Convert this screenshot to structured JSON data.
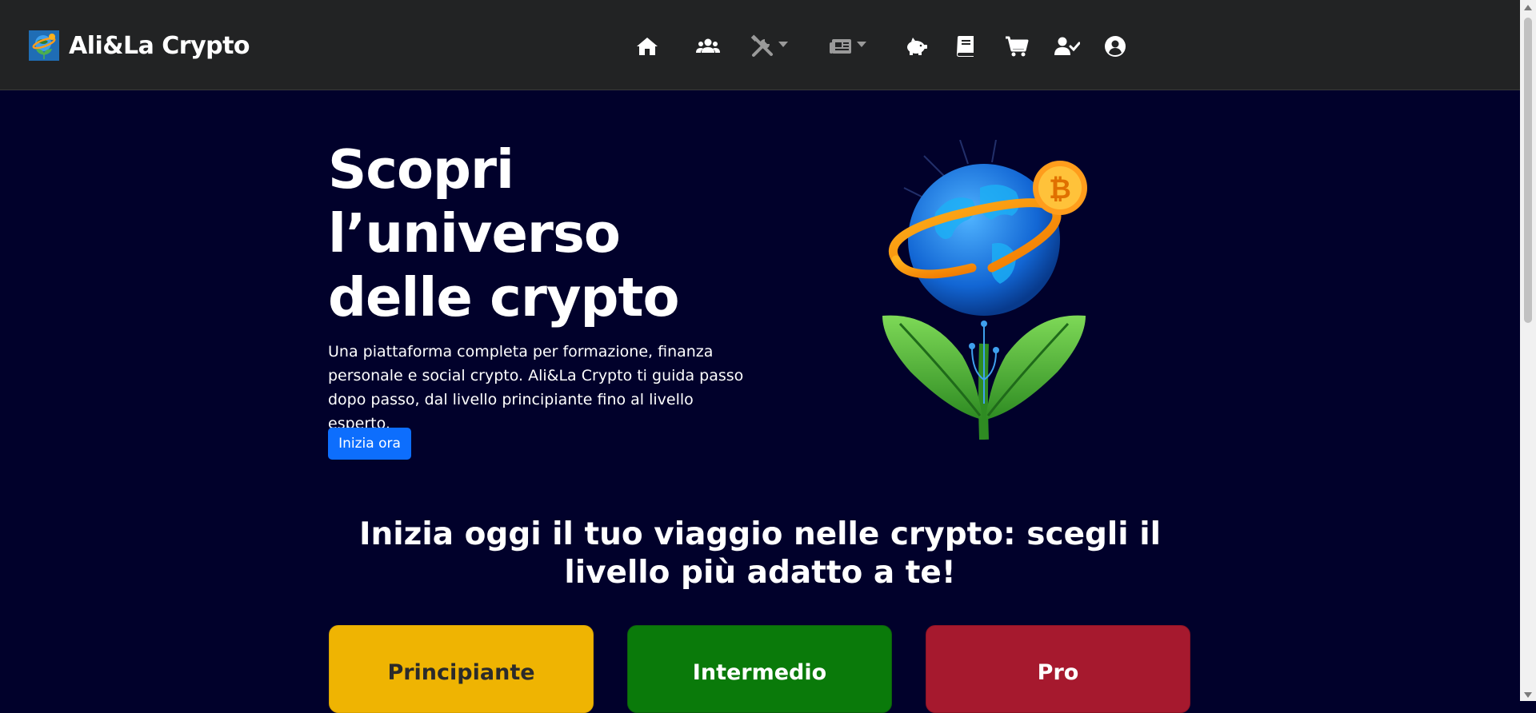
{
  "navbar": {
    "brand_name": "Ali&La Crypto",
    "icons": [
      {
        "name": "home-icon"
      },
      {
        "name": "users-icon"
      },
      {
        "name": "tools-icon",
        "dropdown": true
      },
      {
        "name": "newspaper-icon",
        "dropdown": true
      },
      {
        "name": "piggy-bank-icon"
      },
      {
        "name": "book-icon"
      },
      {
        "name": "cart-icon"
      },
      {
        "name": "user-check-icon"
      },
      {
        "name": "user-circle-icon"
      }
    ]
  },
  "hero": {
    "title_line1": "Scopri",
    "title_line2": "l’universo",
    "title_line3": "delle crypto",
    "description": "Una piattaforma completa per formazione, finanza personale e social crypto. Ali&La Crypto ti guida passo dopo passo, dal livello principiante fino al livello esperto.",
    "cta_label": "Inizia ora",
    "illustration": "globe-bitcoin-plant-illustration"
  },
  "levels": {
    "heading": "Inizia oggi il tuo viaggio nelle crypto: scegli il livello più adatto a te!",
    "cards": [
      {
        "label": "Principiante",
        "color": "#efb402"
      },
      {
        "label": "Intermedio",
        "color": "#0a7a0a"
      },
      {
        "label": "Pro",
        "color": "#a6192e"
      }
    ]
  },
  "colors": {
    "background": "#01012b",
    "navbar": "#222324",
    "primary_button": "#0d6efd"
  }
}
